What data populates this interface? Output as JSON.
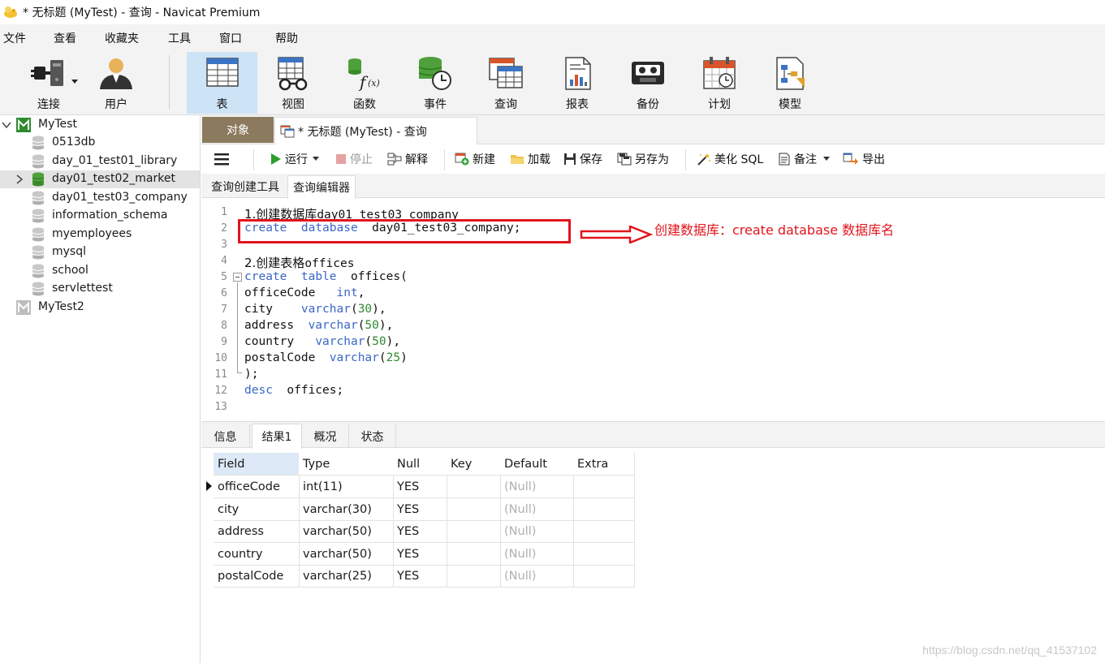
{
  "window": {
    "title": "* 无标题 (MyTest) - 查询 - Navicat Premium"
  },
  "menu": [
    "文件",
    "查看",
    "收藏夹",
    "工具",
    "窗口",
    "帮助"
  ],
  "ribbon": [
    {
      "label": "连接",
      "icon": "connection-plug-icon"
    },
    {
      "label": "用户",
      "icon": "user-icon"
    },
    {
      "label": "表",
      "icon": "table-icon",
      "active": true
    },
    {
      "label": "视图",
      "icon": "view-glasses-icon"
    },
    {
      "label": "函数",
      "icon": "function-icon"
    },
    {
      "label": "事件",
      "icon": "event-clock-icon"
    },
    {
      "label": "查询",
      "icon": "query-icon"
    },
    {
      "label": "报表",
      "icon": "report-icon"
    },
    {
      "label": "备份",
      "icon": "backup-tape-icon"
    },
    {
      "label": "计划",
      "icon": "schedule-calendar-icon"
    },
    {
      "label": "模型",
      "icon": "model-icon"
    }
  ],
  "sidebar": {
    "connections": [
      {
        "name": "MyTest",
        "expanded": true,
        "databases": [
          "0513db",
          "day_01_test01_library",
          "day01_test02_market",
          "day01_test03_company",
          "information_schema",
          "myemployees",
          "mysql",
          "school",
          "servlettest"
        ],
        "selected": "day01_test02_market"
      },
      {
        "name": "MyTest2",
        "expanded": false
      }
    ]
  },
  "tabs": {
    "objects": "对象",
    "query": "* 无标题 (MyTest) - 查询"
  },
  "query_toolbar": {
    "run": "运行",
    "stop": "停止",
    "explain": "解释",
    "new": "新建",
    "load": "加载",
    "save": "保存",
    "save_as": "另存为",
    "beautify": "美化 SQL",
    "note": "备注",
    "export": "导出"
  },
  "editor_tabs": [
    "查询创建工具",
    "查询编辑器"
  ],
  "code": {
    "line_numbers": [
      "1",
      "2",
      "3",
      "4",
      "5",
      "6",
      "7",
      "8",
      "9",
      "10",
      "11",
      "12",
      "13"
    ],
    "l1_cn": "1.创建数据库",
    "l1_rest": "day01 test03 company",
    "l2_kw1": "create",
    "l2_kw2": "database",
    "l2_rest": "day01_test03_company;",
    "l4_cn": "2.创建表格",
    "l4_rest": "offices",
    "l5_kw1": "create",
    "l5_kw2": "table",
    "l5_rest": "offices(",
    "l6_name": "officeCode",
    "l6_type": "int",
    "l6_end": ",",
    "l7_name": "city",
    "l7_type": "varchar",
    "l7_num": "30",
    "l8_name": "address",
    "l8_type": "varchar",
    "l8_num": "50",
    "l9_name": "country",
    "l9_type": "varchar",
    "l9_num": "50",
    "l10_name": "postalCode",
    "l10_type": "varchar",
    "l10_num": "25",
    "l11": ");",
    "l12_kw": "desc",
    "l12_rest": "offices;"
  },
  "annotation": "创建数据库：create   database  数据库名",
  "result_tabs": [
    "信息",
    "结果1",
    "概况",
    "状态"
  ],
  "results": {
    "columns": [
      "Field",
      "Type",
      "Null",
      "Key",
      "Default",
      "Extra"
    ],
    "rows": [
      [
        "officeCode",
        "int(11)",
        "YES",
        "",
        "(Null)",
        ""
      ],
      [
        "city",
        "varchar(30)",
        "YES",
        "",
        "(Null)",
        ""
      ],
      [
        "address",
        "varchar(50)",
        "YES",
        "",
        "(Null)",
        ""
      ],
      [
        "country",
        "varchar(50)",
        "YES",
        "",
        "(Null)",
        ""
      ],
      [
        "postalCode",
        "varchar(25)",
        "YES",
        "",
        "(Null)",
        ""
      ]
    ]
  },
  "watermark": "https://blog.csdn.net/qq_41537102"
}
